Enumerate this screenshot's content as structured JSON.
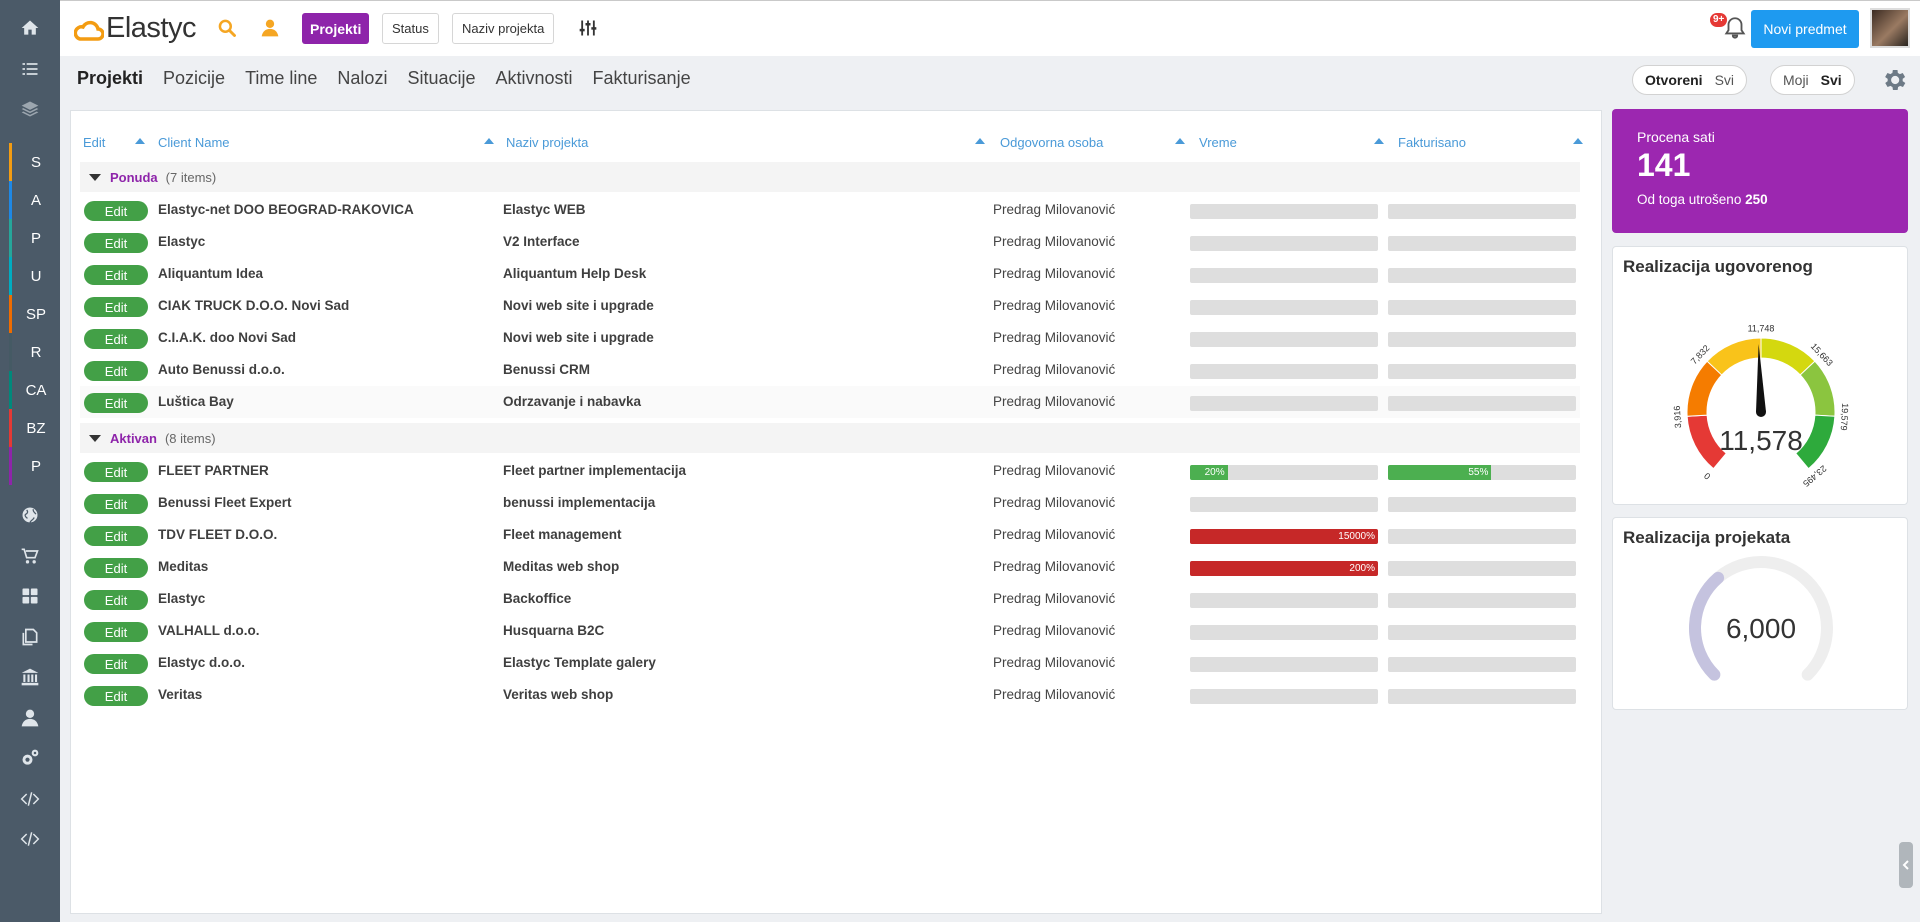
{
  "brand": {
    "name": "Elastyc",
    "accent": "#8e24aa",
    "primary": "#1e9af0",
    "success": "#43a047",
    "danger": "#c62828"
  },
  "sidebar": {
    "top_icons": [
      "home-icon",
      "list-icon",
      "layers-icon"
    ],
    "letters": [
      {
        "label": "S",
        "color": "#f39c12"
      },
      {
        "label": "A",
        "color": "#1e88e5"
      },
      {
        "label": "P",
        "color": "#26a69a"
      },
      {
        "label": "U",
        "color": "#00acc1"
      },
      {
        "label": "SP",
        "color": "#ef6c00"
      },
      {
        "label": "R",
        "color": "#455a64"
      },
      {
        "label": "CA",
        "color": "#00897b"
      },
      {
        "label": "BZ",
        "color": "#e53935"
      },
      {
        "label": "P",
        "color": "#8e24aa"
      }
    ],
    "bottom_icons": [
      "globe-icon",
      "cart-icon",
      "dashboard-icon",
      "documents-icon",
      "bank-icon",
      "user-icon",
      "gears-icon",
      "code-icon",
      "code-icon"
    ]
  },
  "header": {
    "projekti_label": "Projekti",
    "status_label": "Status",
    "naziv_label": "Naziv projekta",
    "notifications_badge": "9+",
    "new_button": "Novi predmet"
  },
  "tabs": [
    "Projekti",
    "Pozicije",
    "Time line",
    "Nalozi",
    "Situacije",
    "Aktivnosti",
    "Fakturisanje"
  ],
  "toggles": {
    "open_all": {
      "on": "Otvoreni",
      "off": "Svi"
    },
    "mine_all": {
      "off": "Moji",
      "on": "Svi"
    }
  },
  "table": {
    "columns": [
      "Edit",
      "Client Name",
      "Naziv projekta",
      "Odgovorna osoba",
      "Vreme",
      "Fakturisano"
    ],
    "edit_label": "Edit",
    "groups": [
      {
        "name": "Ponuda",
        "count": "(7 items)",
        "rows": [
          {
            "client": "Elastyc-net DOO BEOGRAD-RAKOVICA",
            "project": "Elastyc WEB",
            "person": "Predrag Milovanović",
            "vreme": null,
            "fakt": null
          },
          {
            "client": "Elastyc",
            "project": "V2 Interface",
            "person": "Predrag Milovanović",
            "vreme": null,
            "fakt": null
          },
          {
            "client": "Aliquantum Idea",
            "project": "Aliquantum Help Desk",
            "person": "Predrag Milovanović",
            "vreme": null,
            "fakt": null
          },
          {
            "client": "CIAK TRUCK D.O.O. Novi Sad",
            "project": "Novi web site i upgrade",
            "person": "Predrag Milovanović",
            "vreme": null,
            "fakt": null
          },
          {
            "client": "C.I.A.K. doo Novi Sad",
            "project": "Novi web site i upgrade",
            "person": "Predrag Milovanović",
            "vreme": null,
            "fakt": null
          },
          {
            "client": "Auto Benussi d.o.o.",
            "project": "Benussi CRM",
            "person": "Predrag Milovanović",
            "vreme": null,
            "fakt": null
          },
          {
            "client": "Luštica Bay",
            "project": "Odrzavanje i nabavka",
            "person": "Predrag Milovanović",
            "vreme": null,
            "fakt": null
          }
        ]
      },
      {
        "name": "Aktivan",
        "count": "(8 items)",
        "rows": [
          {
            "client": "FLEET PARTNER",
            "project": "Fleet partner implementacija",
            "person": "Predrag Milovanović",
            "vreme": {
              "label": "20%",
              "fraction": 0.2,
              "color": "#4caf50"
            },
            "fakt": {
              "label": "55%",
              "fraction": 0.55,
              "color": "#4caf50"
            }
          },
          {
            "client": "Benussi Fleet Expert",
            "project": "benussi implementacija",
            "person": "Predrag Milovanović",
            "vreme": null,
            "fakt": null
          },
          {
            "client": "TDV FLEET D.O.O.",
            "project": "Fleet management",
            "person": "Predrag Milovanović",
            "vreme": {
              "label": "15000%",
              "fraction": 1,
              "color": "#c62828"
            },
            "fakt": null
          },
          {
            "client": "Meditas",
            "project": "Meditas web shop",
            "person": "Predrag Milovanović",
            "vreme": {
              "label": "200%",
              "fraction": 1,
              "color": "#c62828"
            },
            "fakt": null
          },
          {
            "client": "Elastyc",
            "project": "Backoffice",
            "person": "Predrag Milovanović",
            "vreme": null,
            "fakt": null
          },
          {
            "client": "VALHALL d.o.o.",
            "project": "Husquarna B2C",
            "person": "Predrag Milovanović",
            "vreme": null,
            "fakt": null
          },
          {
            "client": "Elastyc d.o.o.",
            "project": "Elastyc Template galery",
            "person": "Predrag Milovanović",
            "vreme": null,
            "fakt": null
          },
          {
            "client": "Veritas",
            "project": "Veritas web shop",
            "person": "Predrag Milovanović",
            "vreme": null,
            "fakt": null
          }
        ]
      }
    ]
  },
  "stats": {
    "procena_label": "Procena sati",
    "procena_value": "141",
    "utroseno_label": "Od toga utrošeno",
    "utroseno_value": "250"
  },
  "gauge": {
    "title": "Realizacija ugovorenog",
    "value": 11578,
    "value_label": "11,578",
    "max": 23495,
    "ticks": [
      "0",
      "3,916",
      "7,832",
      "11,748",
      "15,663",
      "19,579",
      "23,495"
    ],
    "band_colors": [
      "#e53935",
      "#f57c00",
      "#f9c31a",
      "#d4d80f",
      "#8bc53f",
      "#2eaa3c"
    ]
  },
  "ring": {
    "title": "Realizacija projekata",
    "value_label": "6,000",
    "fraction": 0.35
  }
}
